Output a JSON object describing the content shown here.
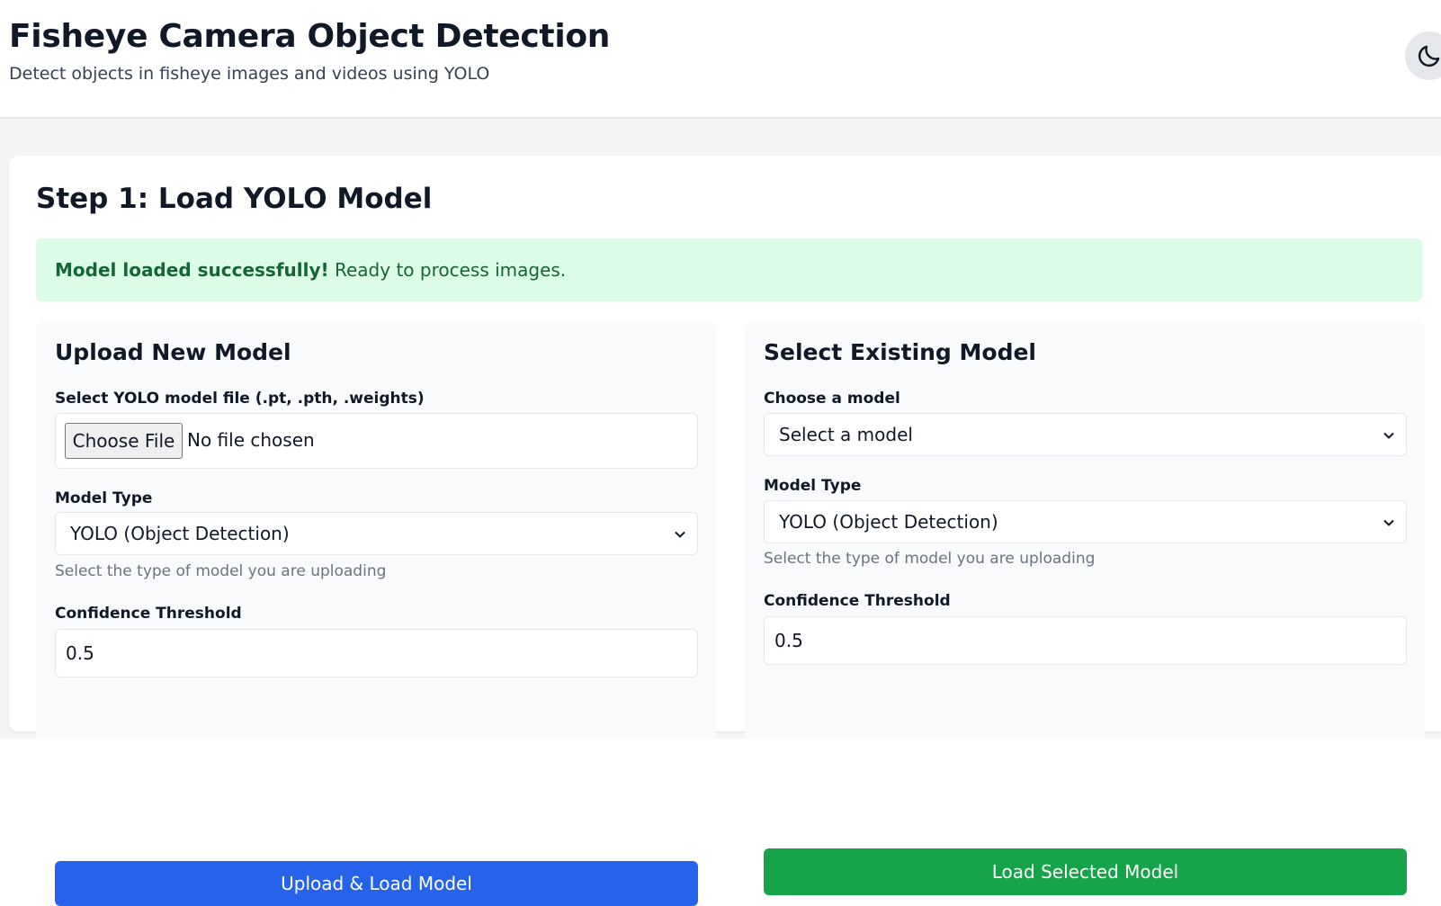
{
  "header": {
    "title": "Fisheye Camera Object Detection",
    "subtitle": "Detect objects in fisheye images and videos using YOLO",
    "theme_toggle_icon": "moon-icon"
  },
  "step": {
    "title": "Step 1: Load YOLO Model",
    "alert": {
      "strong": "Model loaded successfully!",
      "text": " Ready to process images.",
      "color": "#166534",
      "background": "#dcfce7"
    }
  },
  "upload_panel": {
    "title": "Upload New Model",
    "file_label": "Select YOLO model file (.pt, .pth, .weights)",
    "choose_file_button": "Choose File",
    "file_status": "No file chosen",
    "model_type_label": "Model Type",
    "model_type_value": "YOLO (Object Detection)",
    "model_type_help": "Select the type of model you are uploading",
    "confidence_label": "Confidence Threshold",
    "confidence_value": "0.5",
    "submit_button": "Upload & Load Model",
    "submit_color": "#2563eb"
  },
  "existing_panel": {
    "title": "Select Existing Model",
    "choose_label": "Choose a model",
    "choose_value": "Select a model",
    "model_type_label": "Model Type",
    "model_type_value": "YOLO (Object Detection)",
    "model_type_help": "Select the type of model you are uploading",
    "confidence_label": "Confidence Threshold",
    "confidence_value": "0.5",
    "submit_button": "Load Selected Model",
    "submit_color": "#16a34a"
  }
}
